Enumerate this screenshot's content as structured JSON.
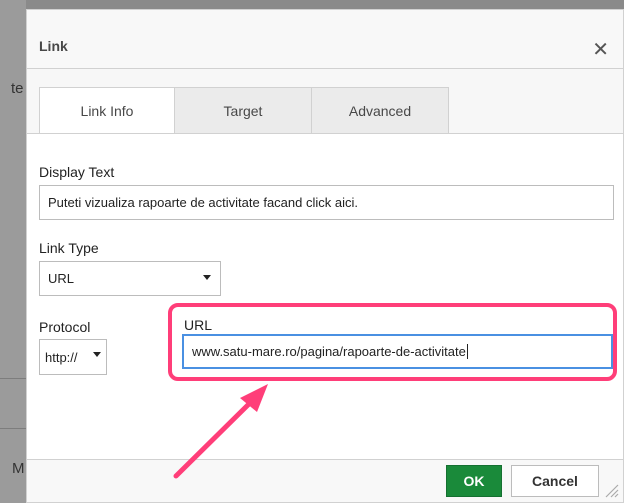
{
  "background": {
    "fragment_top": "te",
    "fragment_bottom": "M"
  },
  "dialog": {
    "title": "Link",
    "close_icon": "close-icon"
  },
  "tabs": [
    {
      "label": "Link Info",
      "active": true
    },
    {
      "label": "Target",
      "active": false
    },
    {
      "label": "Advanced",
      "active": false
    }
  ],
  "form": {
    "display_text_label": "Display Text",
    "display_text_value": "Puteti vizualiza rapoarte de activitate facand click aici.",
    "link_type_label": "Link Type",
    "link_type_value": "URL",
    "protocol_label": "Protocol",
    "protocol_value": "http://",
    "url_label": "URL",
    "url_value": "www.satu-mare.ro/pagina/rapoarte-de-activitate"
  },
  "buttons": {
    "ok": "OK",
    "cancel": "Cancel"
  },
  "colors": {
    "highlight": "#ff3e79",
    "ok_button": "#1a8a3a",
    "focus_border": "#4a90e2"
  }
}
